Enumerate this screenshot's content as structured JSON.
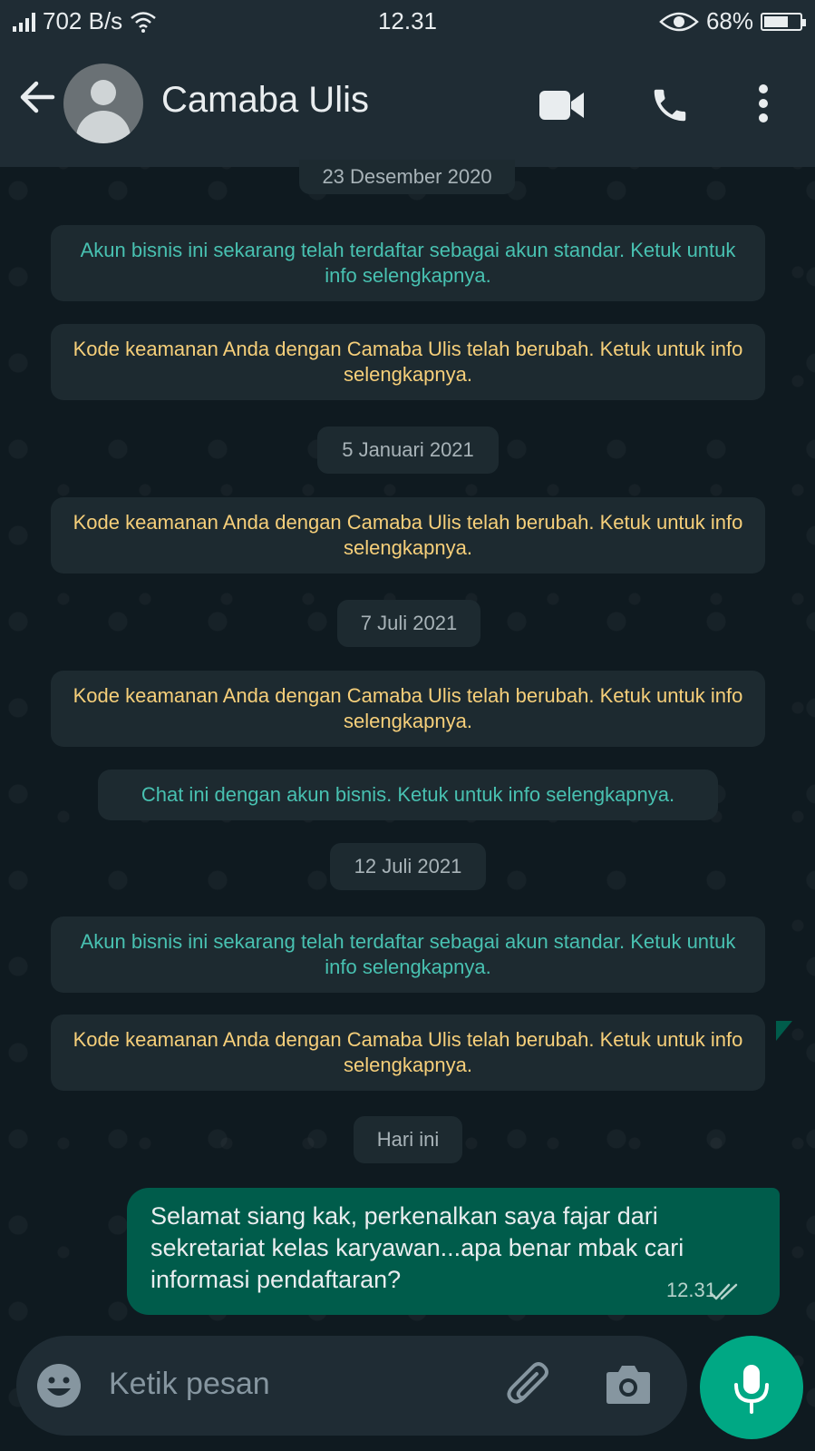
{
  "status_bar": {
    "network_speed": "702 B/s",
    "time": "12.31",
    "battery_percent": "68%",
    "battery_level": 0.68,
    "icons": [
      "signal-icon",
      "wifi-icon",
      "eye-icon",
      "battery-icon"
    ]
  },
  "header": {
    "contact_name": "Camaba Ulis",
    "icons": [
      "back-arrow-icon",
      "avatar-icon",
      "video-call-icon",
      "phone-icon",
      "more-vert-icon"
    ]
  },
  "chat": {
    "date_1": "23 Desember 2020",
    "msg_1": "Akun bisnis ini sekarang telah terdaftar sebagai akun standar. Ketuk untuk info selengkapnya.",
    "msg_2": "Kode keamanan Anda dengan Camaba Ulis telah berubah. Ketuk untuk info selengkapnya.",
    "date_2": "5 Januari 2021",
    "msg_3": "Kode keamanan Anda dengan Camaba Ulis telah berubah. Ketuk untuk info selengkapnya.",
    "date_3": "7 Juli 2021",
    "msg_4": "Kode keamanan Anda dengan Camaba Ulis telah berubah. Ketuk untuk info selengkapnya.",
    "msg_5": "Chat ini dengan akun bisnis. Ketuk untuk info selengkapnya.",
    "date_4": "12 Juli 2021",
    "msg_6": "Akun bisnis ini sekarang telah terdaftar sebagai akun standar. Ketuk untuk info selengkapnya.",
    "msg_7": "Kode keamanan Anda dengan Camaba Ulis telah berubah. Ketuk untuk info selengkapnya.",
    "date_5": "Hari ini",
    "outgoing": {
      "text": "Selamat siang kak, perkenalkan saya fajar dari sekretariat kelas karyawan...apa benar mbak cari informasi pendaftaran?",
      "time": "12.31",
      "status_icon": "double-check-icon"
    }
  },
  "composer": {
    "placeholder": "Ketik pesan",
    "icons": [
      "emoji-icon",
      "attach-icon",
      "camera-icon",
      "mic-icon"
    ]
  },
  "colors": {
    "header_bg": "#1f2c34",
    "outgoing_bubble": "#005c4b",
    "accent": "#00a884",
    "system_teal": "#48c1b1",
    "system_yellow": "#f6cf7a"
  }
}
